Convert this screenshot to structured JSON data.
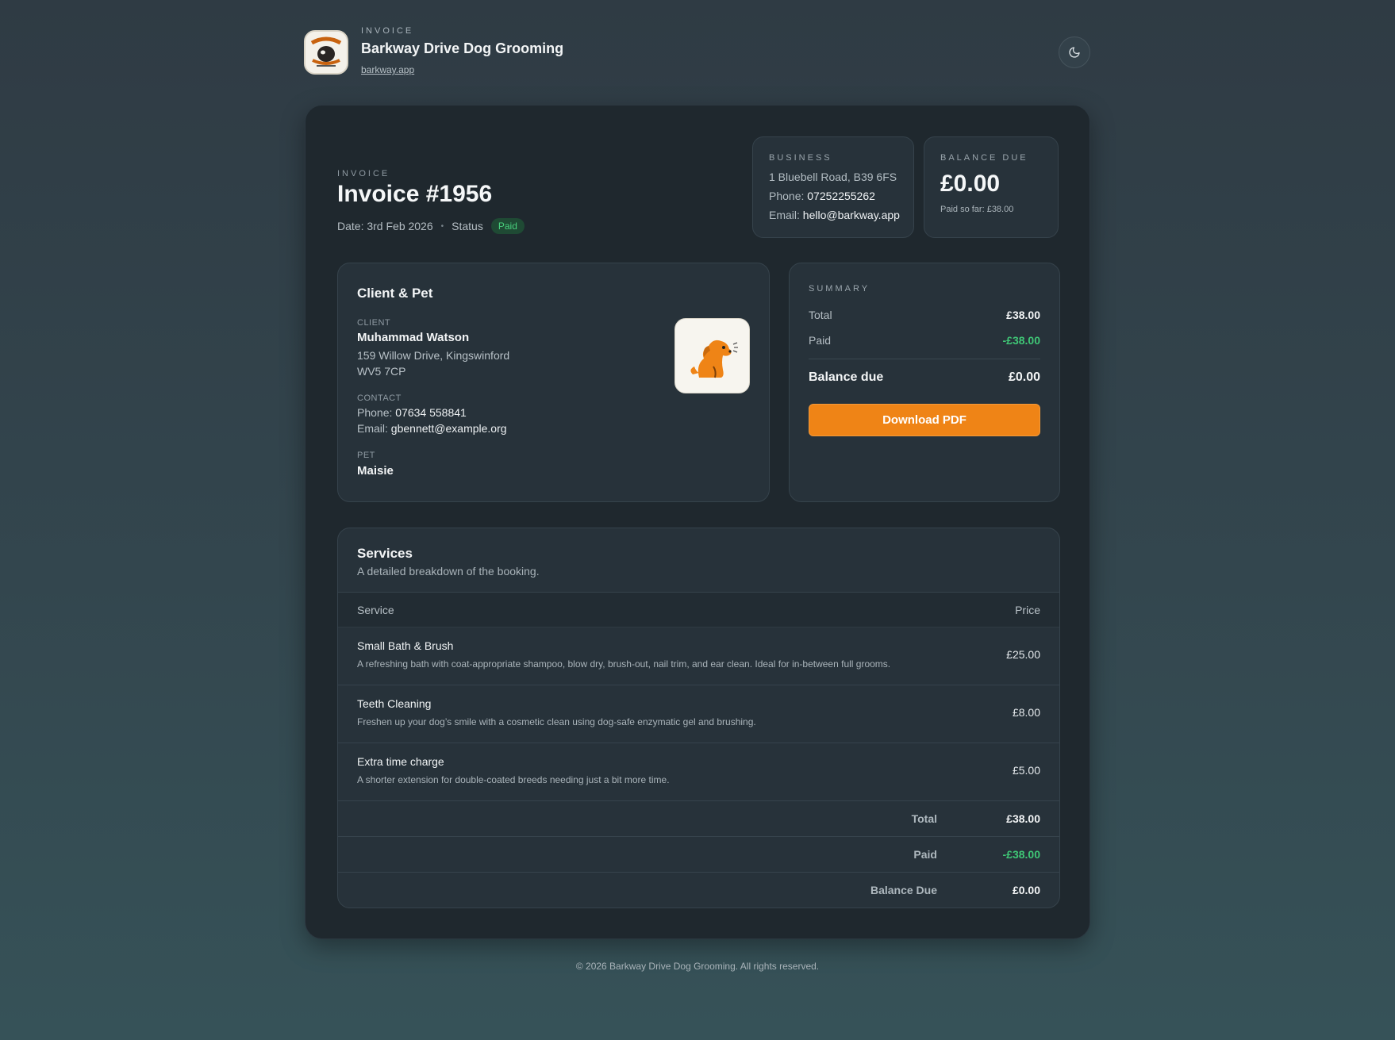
{
  "header": {
    "kicker": "INVOICE",
    "business_name": "Barkway Drive Dog Grooming",
    "link": "barkway.app",
    "theme_icon": "moon-icon"
  },
  "invoice": {
    "kicker": "INVOICE",
    "title": "Invoice #1956",
    "date": "Date: 3rd Feb 2026",
    "status_label": "Status",
    "status": "Paid"
  },
  "business": {
    "kicker": "BUSINESS",
    "address": "1 Bluebell Road, B39 6FS",
    "phone_label": "Phone: ",
    "phone": "07252255262",
    "email_label": "Email: ",
    "email": "hello@barkway.app"
  },
  "balance": {
    "kicker": "BALANCE DUE",
    "amount": "£0.00",
    "paid_so_far": "Paid so far: £38.00"
  },
  "client_pet": {
    "title": "Client & Pet",
    "client_label": "CLIENT",
    "client_name": "Muhammad Watson",
    "address_line1": "159 Willow Drive, Kingswinford",
    "address_line2": "WV5 7CP",
    "contact_label": "CONTACT",
    "phone_label": "Phone: ",
    "phone": "07634 558841",
    "email_label": "Email: ",
    "email": "gbennett@example.org",
    "pet_label": "PET",
    "pet_name": "Maisie",
    "pet_icon": "dog-icon"
  },
  "summary": {
    "kicker": "SUMMARY",
    "total_label": "Total",
    "total": "£38.00",
    "paid_label": "Paid",
    "paid": "-£38.00",
    "balance_label": "Balance due",
    "balance": "£0.00",
    "download_label": "Download PDF"
  },
  "services": {
    "title": "Services",
    "subtitle": "A detailed breakdown of the booking.",
    "col_service": "Service",
    "col_price": "Price",
    "items": [
      {
        "name": "Small Bath & Brush",
        "desc": "A refreshing bath with coat-appropriate shampoo, blow dry, brush-out, nail trim, and ear clean. Ideal for in-between full grooms.",
        "price": "£25.00"
      },
      {
        "name": "Teeth Cleaning",
        "desc": "Freshen up your dog’s smile with a cosmetic clean using dog-safe enzymatic gel and brushing.",
        "price": "£8.00"
      },
      {
        "name": "Extra time charge",
        "desc": "A shorter extension for double-coated breeds needing just a bit more time.",
        "price": "£5.00"
      }
    ],
    "totals": [
      {
        "label": "Total",
        "value": "£38.00"
      },
      {
        "label": "Paid",
        "value": "-£38.00"
      },
      {
        "label": "Balance Due",
        "value": "£0.00"
      }
    ]
  },
  "footer": "© 2026 Barkway Drive Dog Grooming. All rights reserved.",
  "colors": {
    "accent": "#ef8416",
    "paid_green": "#3fc776"
  }
}
